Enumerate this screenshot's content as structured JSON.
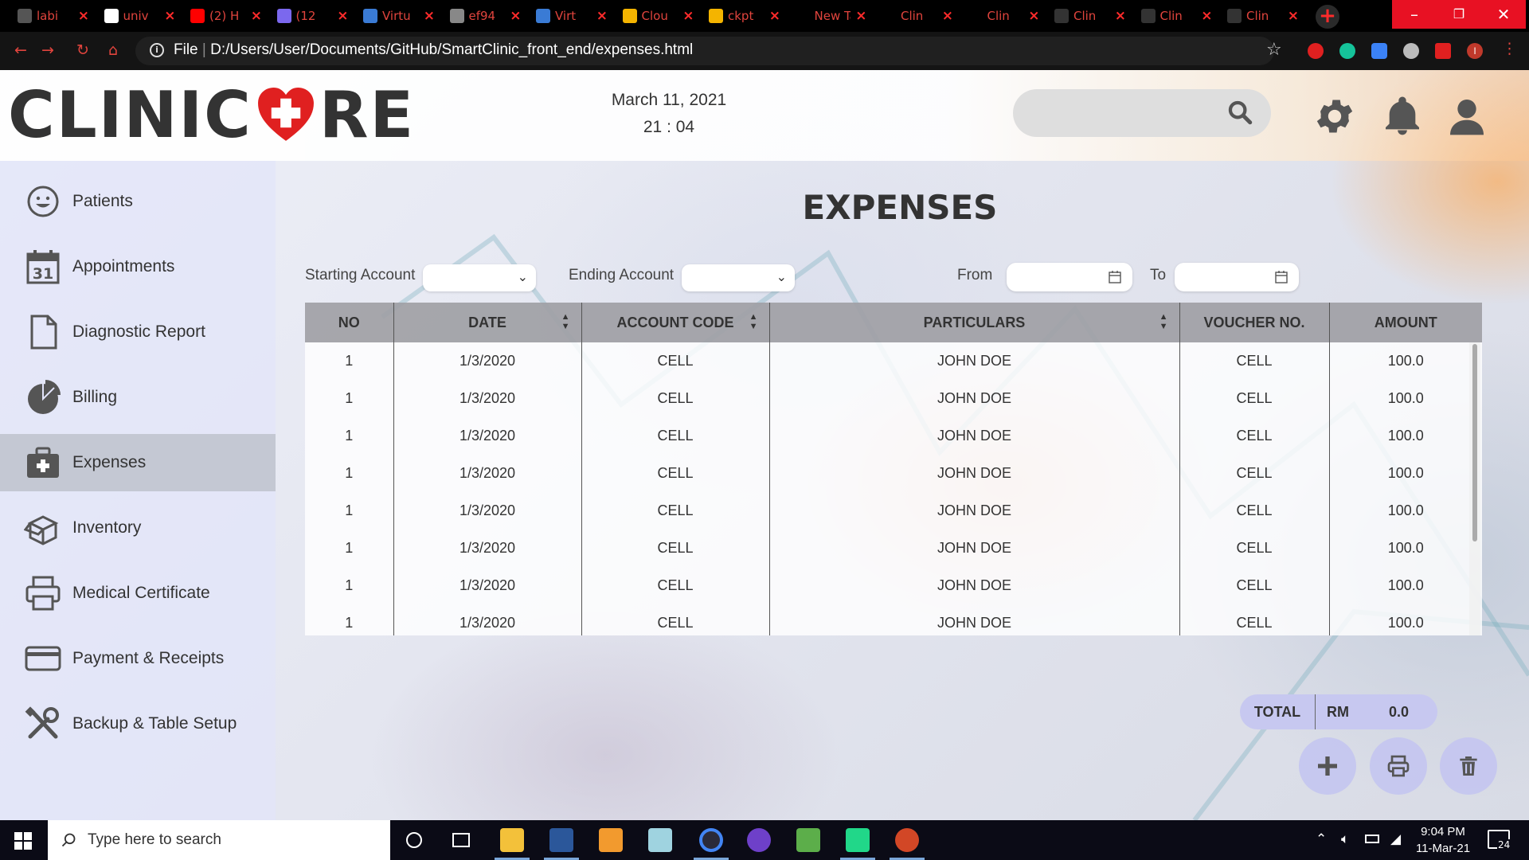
{
  "browser": {
    "tabs": [
      {
        "label": "labi",
        "icon_color": "#555555"
      },
      {
        "label": "univ",
        "icon_color": "#ffffff"
      },
      {
        "label": "(2) H",
        "icon_color": "#ff0000"
      },
      {
        "label": "(12",
        "icon_color": "#7b68ee"
      },
      {
        "label": "Virtu",
        "icon_color": "#3a7bd5"
      },
      {
        "label": "ef94",
        "icon_color": "#888888"
      },
      {
        "label": "Virt",
        "icon_color": "#3a7bd5"
      },
      {
        "label": "Clou",
        "icon_color": "#f4b400"
      },
      {
        "label": "ckpt",
        "icon_color": "#f4b400"
      },
      {
        "label": "New Tab",
        "icon_color": "#000000"
      },
      {
        "label": "Clin",
        "icon_color": "#000000"
      },
      {
        "label": "Clin",
        "icon_color": "#000000"
      },
      {
        "label": "Clin",
        "icon_color": "#333333"
      },
      {
        "label": "Clin",
        "icon_color": "#333333"
      },
      {
        "label": "Clin",
        "icon_color": "#333333"
      }
    ],
    "url_scheme": "File",
    "url": "D:/Users/User/Documents/GitHub/SmartClinic_front_end/expenses.html",
    "profile_initial": "I"
  },
  "header": {
    "logo_left": "CLINIC",
    "logo_right": "RE",
    "date": "March 11, 2021",
    "time": "21 : 04",
    "search_placeholder": ""
  },
  "sidebar": {
    "items": [
      {
        "label": "Patients",
        "icon": "smile-face-icon",
        "active": false
      },
      {
        "label": "Appointments",
        "icon": "calendar-31-icon",
        "active": false
      },
      {
        "label": "Diagnostic Report",
        "icon": "document-icon",
        "active": false
      },
      {
        "label": "Billing",
        "icon": "pie-chart-icon",
        "active": false
      },
      {
        "label": "Expenses",
        "icon": "medical-briefcase-icon",
        "active": true
      },
      {
        "label": "Inventory",
        "icon": "open-box-icon",
        "active": false
      },
      {
        "label": "Medical Certificate",
        "icon": "printer-icon",
        "active": false
      },
      {
        "label": "Payment & Receipts",
        "icon": "credit-card-icon",
        "active": false
      },
      {
        "label": "Backup & Table Setup",
        "icon": "tools-icon",
        "active": false
      }
    ]
  },
  "main": {
    "title": "EXPENSES",
    "filters": {
      "starting_account_label": "Starting Account",
      "starting_account_value": "",
      "ending_account_label": "Ending Account",
      "ending_account_value": "",
      "from_label": "From",
      "to_label": "To"
    },
    "table": {
      "columns": [
        "NO",
        "DATE",
        "ACCOUNT CODE",
        "PARTICULARS",
        "VOUCHER NO.",
        "AMOUNT"
      ],
      "sortable": [
        false,
        true,
        true,
        true,
        false,
        false
      ],
      "rows": [
        [
          "1",
          "1/3/2020",
          "CELL",
          "JOHN DOE",
          "CELL",
          "100.0"
        ],
        [
          "1",
          "1/3/2020",
          "CELL",
          "JOHN DOE",
          "CELL",
          "100.0"
        ],
        [
          "1",
          "1/3/2020",
          "CELL",
          "JOHN DOE",
          "CELL",
          "100.0"
        ],
        [
          "1",
          "1/3/2020",
          "CELL",
          "JOHN DOE",
          "CELL",
          "100.0"
        ],
        [
          "1",
          "1/3/2020",
          "CELL",
          "JOHN DOE",
          "CELL",
          "100.0"
        ],
        [
          "1",
          "1/3/2020",
          "CELL",
          "JOHN DOE",
          "CELL",
          "100.0"
        ],
        [
          "1",
          "1/3/2020",
          "CELL",
          "JOHN DOE",
          "CELL",
          "100.0"
        ],
        [
          "1",
          "1/3/2020",
          "CELL",
          "JOHN DOE",
          "CELL",
          "100.0"
        ]
      ]
    },
    "total": {
      "label": "TOTAL",
      "currency": "RM",
      "value": "0.0"
    },
    "actions": [
      "add-icon",
      "print-icon",
      "trash-icon"
    ]
  },
  "taskbar": {
    "search_placeholder": "Type here to search",
    "time": "9:04 PM",
    "date": "11-Mar-21",
    "notification_count": "24"
  },
  "colors": {
    "accent": "#c7c8f0",
    "sidebar_active": "#bec2cd",
    "logo_heart": "#e02020",
    "tab_text": "#e0443d"
  }
}
